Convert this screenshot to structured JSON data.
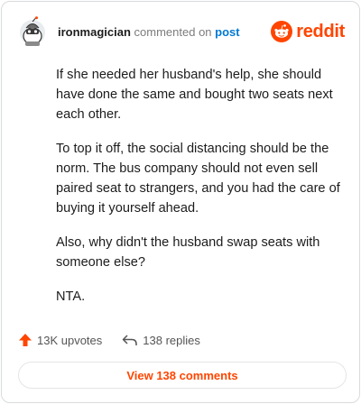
{
  "header": {
    "username": "ironmagician",
    "verb": "commented on",
    "target": "post",
    "logo_text": "reddit",
    "avatar_icon": "snoo-avatar-icon",
    "logo_icon": "reddit-alien-icon"
  },
  "comment": {
    "paragraphs": [
      "If she needed her husband's help, she should have done the same and bought two seats next each other.",
      "To top it off, the social distancing should be the norm. The bus company should not even sell paired seat to strangers, and you had the care of buying it yourself ahead.",
      "Also, why didn't the husband swap seats with someone else?",
      "NTA."
    ]
  },
  "actions": {
    "upvotes": "13K upvotes",
    "replies": "138 replies",
    "upvote_icon": "upvote-arrow-icon",
    "reply_icon": "reply-arrow-icon"
  },
  "footer": {
    "view_label": "View 138 comments"
  },
  "colors": {
    "brand": "#ff4500",
    "link": "#0079d3",
    "border": "#d9dbdc"
  }
}
